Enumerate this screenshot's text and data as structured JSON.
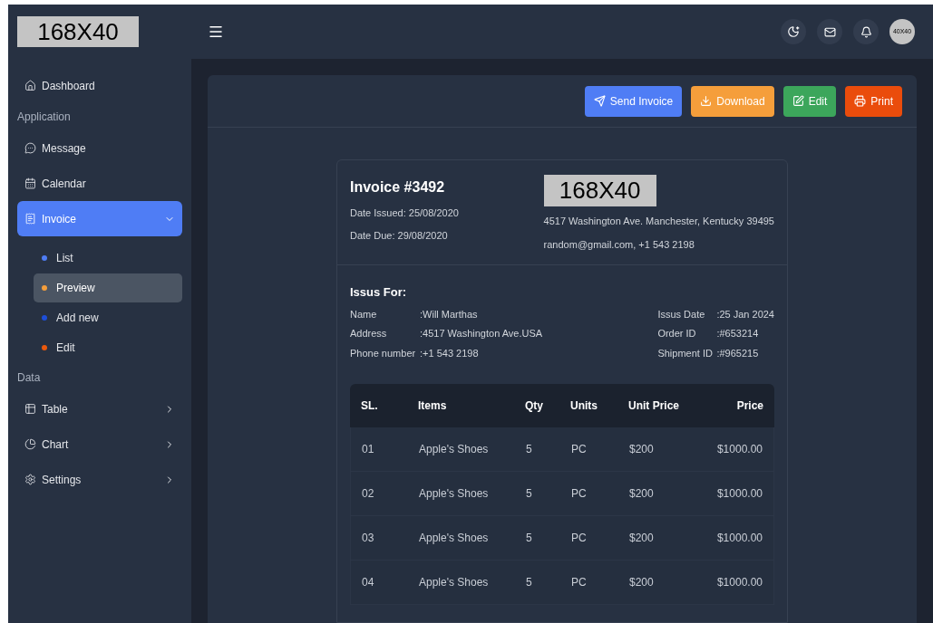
{
  "logo": "168X40",
  "sidebar": {
    "items": [
      {
        "kind": "link",
        "label": "Dashboard",
        "selected": false
      },
      {
        "kind": "section",
        "label": "Application"
      },
      {
        "kind": "link",
        "label": "Message",
        "selected": false
      },
      {
        "kind": "link",
        "label": "Calendar",
        "selected": false
      },
      {
        "kind": "group",
        "label": "Invoice",
        "selected": true,
        "expanded": true,
        "children": [
          {
            "label": "List",
            "color": "#4f7df5",
            "selected": false
          },
          {
            "label": "Preview",
            "color": "#f59e3b",
            "selected": true
          },
          {
            "label": "Add new",
            "color": "#1d4ed8",
            "selected": false
          },
          {
            "label": "Edit",
            "color": "#ea580c",
            "selected": false
          }
        ]
      },
      {
        "kind": "section",
        "label": "Data"
      },
      {
        "kind": "group",
        "label": "Table",
        "selected": false,
        "expanded": false
      },
      {
        "kind": "group",
        "label": "Chart",
        "selected": false,
        "expanded": false
      },
      {
        "kind": "group",
        "label": "Settings",
        "selected": false,
        "expanded": false
      }
    ]
  },
  "topbar": {
    "avatar": "40X40"
  },
  "actions": [
    {
      "label": "Send Invoice",
      "kind": "send",
      "color": "#4f7df5"
    },
    {
      "label": "Download",
      "kind": "download",
      "color": "#f59e3b"
    },
    {
      "label": "Edit",
      "kind": "edit",
      "color": "#3ca65b"
    },
    {
      "label": "Print",
      "kind": "print",
      "color": "#ea4c0c"
    }
  ],
  "invoice": {
    "title": "Invoice #3492",
    "date_issued": "Date Issued: 25/08/2020",
    "date_due": "Date Due: 29/08/2020",
    "logo": "168X40",
    "address": "4517 Washington Ave. Manchester, Kentucky 39495",
    "contact": "random@gmail.com, +1 543 2198",
    "issued_for": {
      "heading": "Issus For:",
      "left": [
        {
          "label": "Name",
          "value": ":Will Marthas"
        },
        {
          "label": "Address",
          "value": ":4517 Washington Ave.USA"
        },
        {
          "label": "Phone number",
          "value": ":+1 543 2198"
        }
      ],
      "right": [
        {
          "label": "Issus Date",
          "value": ":25 Jan 2024"
        },
        {
          "label": "Order ID",
          "value": ":#653214"
        },
        {
          "label": "Shipment ID",
          "value": ":#965215"
        }
      ]
    },
    "table": {
      "columns": [
        "SL.",
        "Items",
        "Qty",
        "Units",
        "Unit Price",
        "Price"
      ],
      "rows": [
        [
          "01",
          "Apple's Shoes",
          "5",
          "PC",
          "$200",
          "$1000.00"
        ],
        [
          "02",
          "Apple's Shoes",
          "5",
          "PC",
          "$200",
          "$1000.00"
        ],
        [
          "03",
          "Apple's Shoes",
          "5",
          "PC",
          "$200",
          "$1000.00"
        ],
        [
          "04",
          "Apple's Shoes",
          "5",
          "PC",
          "$200",
          "$1000.00"
        ]
      ]
    }
  }
}
